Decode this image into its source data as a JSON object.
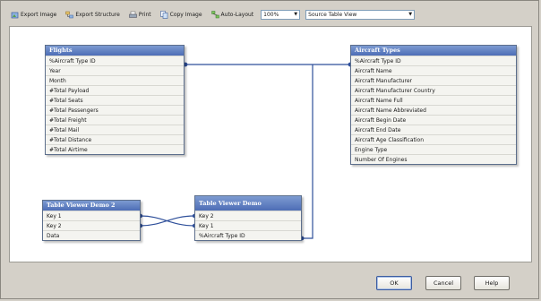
{
  "toolbar": {
    "buttons": [
      {
        "label": "Export Image",
        "icon": "export-image-icon"
      },
      {
        "label": "Export Structure",
        "icon": "export-structure-icon"
      },
      {
        "label": "Print",
        "icon": "print-icon"
      },
      {
        "label": "Copy Image",
        "icon": "copy-image-icon"
      },
      {
        "label": "Auto-Layout",
        "icon": "auto-layout-icon"
      }
    ],
    "zoom_value": "100%",
    "view_value": "Source Table View"
  },
  "tables": {
    "flights": {
      "title": "Flights",
      "fields": [
        "%Aircraft Type ID",
        "Year",
        "Month",
        "#Total Payload",
        "#Total Seats",
        "#Total Passengers",
        "#Total Freight",
        "#Total Mail",
        "#Total Distance",
        "#Total Airtime"
      ]
    },
    "aircraft_types": {
      "title": "Aircraft Types",
      "fields": [
        "%Aircraft Type ID",
        "Aircraft Name",
        "Aircraft Manufacturer",
        "Aircraft Manufacturer Country",
        "Aircraft Name Full",
        "Aircraft Name Abbreviated",
        "Aircraft Begin Date",
        "Aircraft End Date",
        "Aircraft Age Classification",
        "Engine Type",
        "Number Of Engines"
      ]
    },
    "demo2": {
      "title": "Table Viewer Demo 2",
      "fields": [
        "Key 1",
        "Key 2",
        "Data"
      ]
    },
    "demo": {
      "title": "Table Viewer Demo",
      "fields": [
        "Key 2",
        "Key 1",
        "%Aircraft Type ID"
      ]
    }
  },
  "footer": {
    "ok_label": "OK",
    "cancel_label": "Cancel",
    "help_label": "Help"
  },
  "colors": {
    "header_start": "#7d9bd1",
    "header_end": "#4d6db6",
    "link_line": "#2e4f9a",
    "dialog_bg": "#d4d0c8"
  }
}
